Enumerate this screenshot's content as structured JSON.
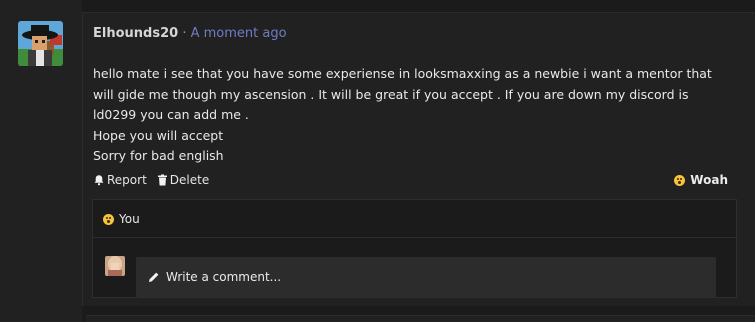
{
  "post": {
    "username": "Elhounds20",
    "separator": "·",
    "timestamp": "A moment ago",
    "message_lines": [
      "hello mate i see that you have some experiense in looksmaxxing as a newbie i want a mentor that will gide me though my ascension . It will be great if you accept . If you are down my discord is ld0299 you can add me .",
      "Hope you will accept",
      "Sorry for bad english"
    ],
    "actions": {
      "report_label": "Report",
      "delete_label": "Delete"
    },
    "reaction": {
      "label": "Woah",
      "icon": "wow-emoji-icon"
    }
  },
  "reactions_panel": {
    "reactors": "You",
    "reaction_icon": "wow-emoji-icon"
  },
  "comment": {
    "placeholder": "Write a comment...",
    "icon": "pencil-icon"
  },
  "colors": {
    "background": "#1b1b1b",
    "panel": "#212121",
    "timestamp_link": "#6f7cc4",
    "emoji": "#f6c33d"
  }
}
